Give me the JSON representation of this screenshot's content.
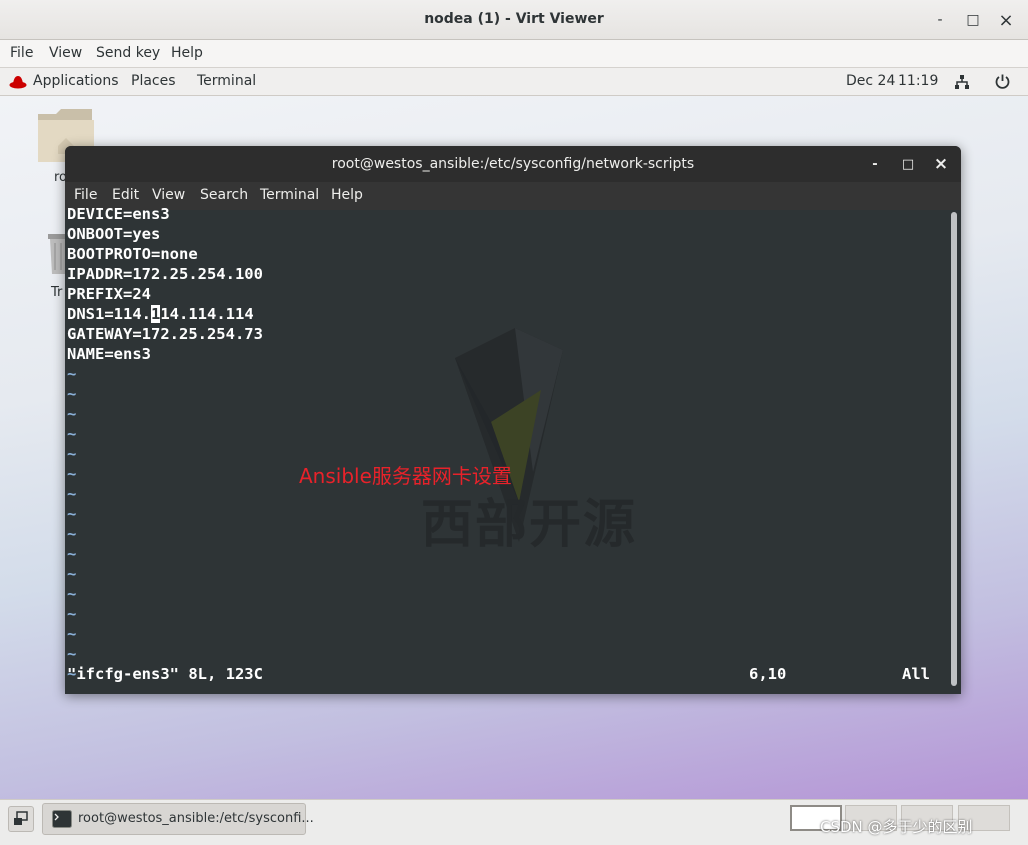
{
  "window": {
    "title": "nodea (1) - Virt Viewer",
    "minimize_label": "-",
    "maximize_label": "□",
    "close_label": "×"
  },
  "viewer_menu": [
    "File",
    "View",
    "Send key",
    "Help"
  ],
  "guest_topbar": {
    "applications": "Applications",
    "places": "Places",
    "terminal": "Terminal",
    "date": "Dec 24",
    "time": "11:19"
  },
  "desktop": {
    "home_label_fragment": "ro",
    "trash_label_fragment": "Tr"
  },
  "terminal": {
    "title": "root@westos_ansible:/etc/sysconfig/network-scripts",
    "menu": [
      "File",
      "Edit",
      "View",
      "Search",
      "Terminal",
      "Help"
    ],
    "file_lines": [
      "DEVICE=ens3",
      "ONBOOT=yes",
      "BOOTPROTO=none",
      "IPADDR=172.25.254.100",
      "PREFIX=24",
      "DNS1=114.114.114.114",
      "GATEWAY=172.25.254.73",
      "NAME=ens3"
    ],
    "cursor_line_prefix": "DNS1=114.",
    "cursor_char": "1",
    "cursor_line_suffix": "14.114.114",
    "empty_marker": "~",
    "status_left": "\"ifcfg-ens3\" 8L, 123C",
    "status_pos": "6,10",
    "status_right": "All"
  },
  "watermark_text": "西部开源",
  "annotation": "Ansible服务器网卡设置",
  "taskbar": {
    "window_label": "root@westos_ansible:/etc/sysconfi..."
  },
  "footer_text": "CSDN @多于少的区别"
}
